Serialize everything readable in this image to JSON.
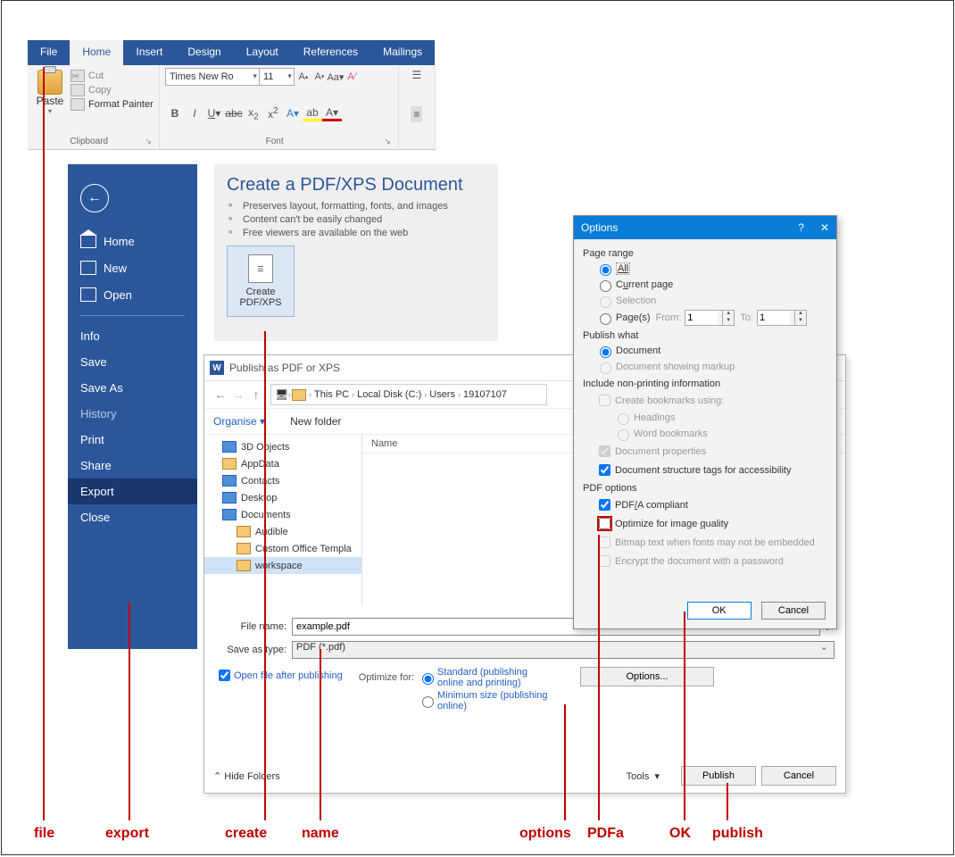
{
  "ribbon": {
    "tabs": [
      "File",
      "Home",
      "Insert",
      "Design",
      "Layout",
      "References",
      "Mailings"
    ],
    "paste": "Paste",
    "cut": "Cut",
    "copy": "Copy",
    "fmtpainter": "Format Painter",
    "group_clip": "Clipboard",
    "font_name": "Times New Ro",
    "font_size": "11",
    "group_font": "Font"
  },
  "backstage": {
    "items": [
      {
        "label": "Home",
        "icon": true
      },
      {
        "label": "New",
        "icon": true
      },
      {
        "label": "Open",
        "icon": true
      },
      {
        "label": "Info"
      },
      {
        "label": "Save"
      },
      {
        "label": "Save As"
      },
      {
        "label": "History",
        "dim": true
      },
      {
        "label": "Print"
      },
      {
        "label": "Share"
      },
      {
        "label": "Export",
        "sel": true
      },
      {
        "label": "Close"
      }
    ]
  },
  "create": {
    "title": "Create a PDF/XPS Document",
    "b1": "Preserves layout, formatting, fonts, and images",
    "b2": "Content can't be easily changed",
    "b3": "Free viewers are available on the web",
    "btn1": "Create",
    "btn2": "PDF/XPS"
  },
  "savedlg": {
    "title": "Publish as PDF or XPS",
    "crumbs": [
      "This PC",
      "Local Disk (C:)",
      "Users",
      "19107107"
    ],
    "organise": "Organise",
    "newfolder": "New folder",
    "tree": [
      {
        "l": "3D Objects",
        "ico": "blue"
      },
      {
        "l": "AppData",
        "ico": "y"
      },
      {
        "l": "Contacts",
        "ico": "blue"
      },
      {
        "l": "Desktop",
        "ico": "blue"
      },
      {
        "l": "Documents",
        "ico": "blue",
        "expanded": true
      },
      {
        "l": "Audible",
        "ico": "y",
        "sub": true
      },
      {
        "l": "Custom Office Templa",
        "ico": "y",
        "sub": true
      },
      {
        "l": "workspace",
        "ico": "y",
        "sub": true,
        "sel": true
      }
    ],
    "col_name": "Name",
    "fname_label": "File name:",
    "fname_value": "example.pdf",
    "type_label": "Save as type:",
    "type_value": "PDF (*.pdf)",
    "open_after": "Open file after publishing",
    "optimize_head": "Optimize for:",
    "opt_std": "Standard (publishing online and printing)",
    "opt_min": "Minimum size (publishing online)",
    "options_btn": "Options...",
    "hide_folders": "Hide Folders",
    "tools": "Tools",
    "publish": "Publish",
    "cancel": "Cancel"
  },
  "optdlg": {
    "title": "Options",
    "g_pagerange": "Page range",
    "r_all": "All",
    "r_current": "Current page",
    "r_selection": "Selection",
    "r_pages": "Page(s)",
    "from": "From:",
    "to": "To:",
    "spin_from": "1",
    "spin_to": "1",
    "g_publishwhat": "Publish what",
    "r_doc": "Document",
    "r_markup": "Document showing markup",
    "g_nonprint": "Include non-printing information",
    "c_bookmarks": "Create bookmarks using:",
    "r_headings": "Headings",
    "r_wordbm": "Word bookmarks",
    "c_props": "Document properties",
    "c_tags": "Document structure tags for accessibility",
    "g_pdfopt": "PDF options",
    "c_pdfa": "PDF/A compliant",
    "c_imgq": "Optimize for image quality",
    "c_bitmap": "Bitmap text when fonts may not be embedded",
    "c_encrypt": "Encrypt the document with a password",
    "ok": "OK",
    "cancel": "Cancel"
  },
  "annot": {
    "file": "file",
    "export": "export",
    "create": "create",
    "name": "name",
    "options": "options",
    "pdfa": "PDFa",
    "ok": "OK",
    "publish": "publish"
  }
}
